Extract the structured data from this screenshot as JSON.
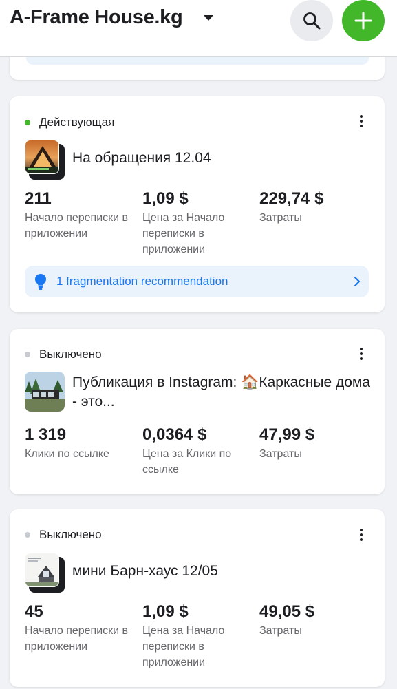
{
  "header": {
    "account_name": "A-Frame House.kg",
    "search_icon": "search-icon",
    "add_icon": "plus-icon"
  },
  "colors": {
    "active_status": "#42b72a",
    "inactive_status": "#c8cbd0",
    "link_blue": "#1877f2",
    "add_button": "#42b72a"
  },
  "ads": [
    {
      "status": "Действующая",
      "status_type": "active",
      "name": "На обращения 12.04",
      "metrics": [
        {
          "value": "211",
          "label": "Начало переписки в приложении"
        },
        {
          "value": "1,09 $",
          "label": "Цена за Начало переписки в приложении"
        },
        {
          "value": "229,74 $",
          "label": "Затраты"
        }
      ],
      "recommendation": "1 fragmentation recommendation",
      "recommendation_icon": "lightbulb-icon"
    },
    {
      "status": "Выключено",
      "status_type": "inactive",
      "name": "Публикация в Instagram: 🏠Каркасные дома - это...",
      "metrics": [
        {
          "value": "1 319",
          "label": "Клики по ссылке"
        },
        {
          "value": "0,0364 $",
          "label": "Цена за Клики по ссылке"
        },
        {
          "value": "47,99 $",
          "label": "Затраты"
        }
      ]
    },
    {
      "status": "Выключено",
      "status_type": "inactive",
      "name": "мини Барн-хаус 12/05",
      "metrics": [
        {
          "value": "45",
          "label": "Начало переписки в приложении"
        },
        {
          "value": "1,09 $",
          "label": "Цена за Начало переписки в приложении"
        },
        {
          "value": "49,05 $",
          "label": "Затраты"
        }
      ]
    }
  ]
}
